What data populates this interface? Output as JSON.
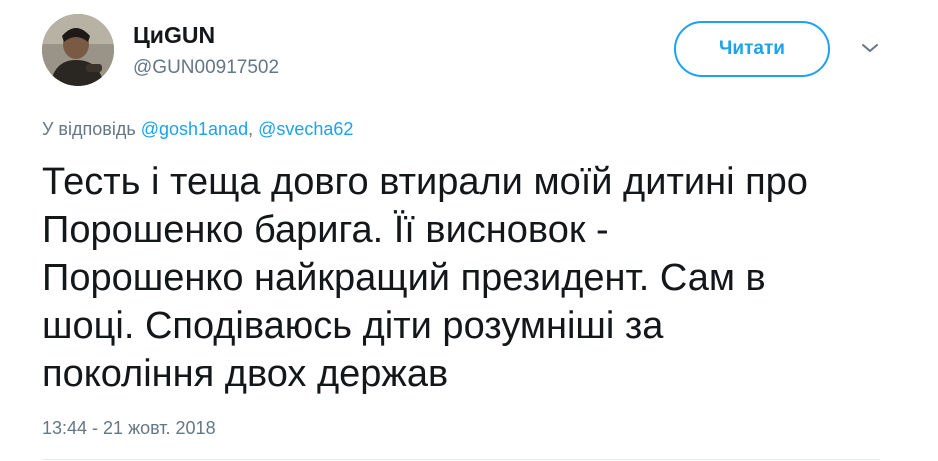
{
  "author": {
    "display_name": "ЦиGUN",
    "handle": "@GUN00917502",
    "avatar_icon": "user-avatar-photo"
  },
  "follow_button": {
    "label": "Читати"
  },
  "menu": {
    "icon": "chevron-down-icon"
  },
  "reply": {
    "prefix": "У відповідь",
    "mentions": [
      "@gosh1anad",
      "@svecha62"
    ],
    "separator": ","
  },
  "tweet": {
    "text_lines": [
      "Тесть і теща довго втирали моїй дитині про",
      "Порошенко барига. Її висновок -",
      "Порошенко найкращий президент. Сам в",
      "шоці. Сподіваюсь діти розумніші за",
      "покоління двох держав"
    ],
    "timestamp": "13:44 - 21 жовт. 2018"
  },
  "colors": {
    "accent": "#1da1f2",
    "text": "#14171a",
    "secondary": "#657786"
  }
}
